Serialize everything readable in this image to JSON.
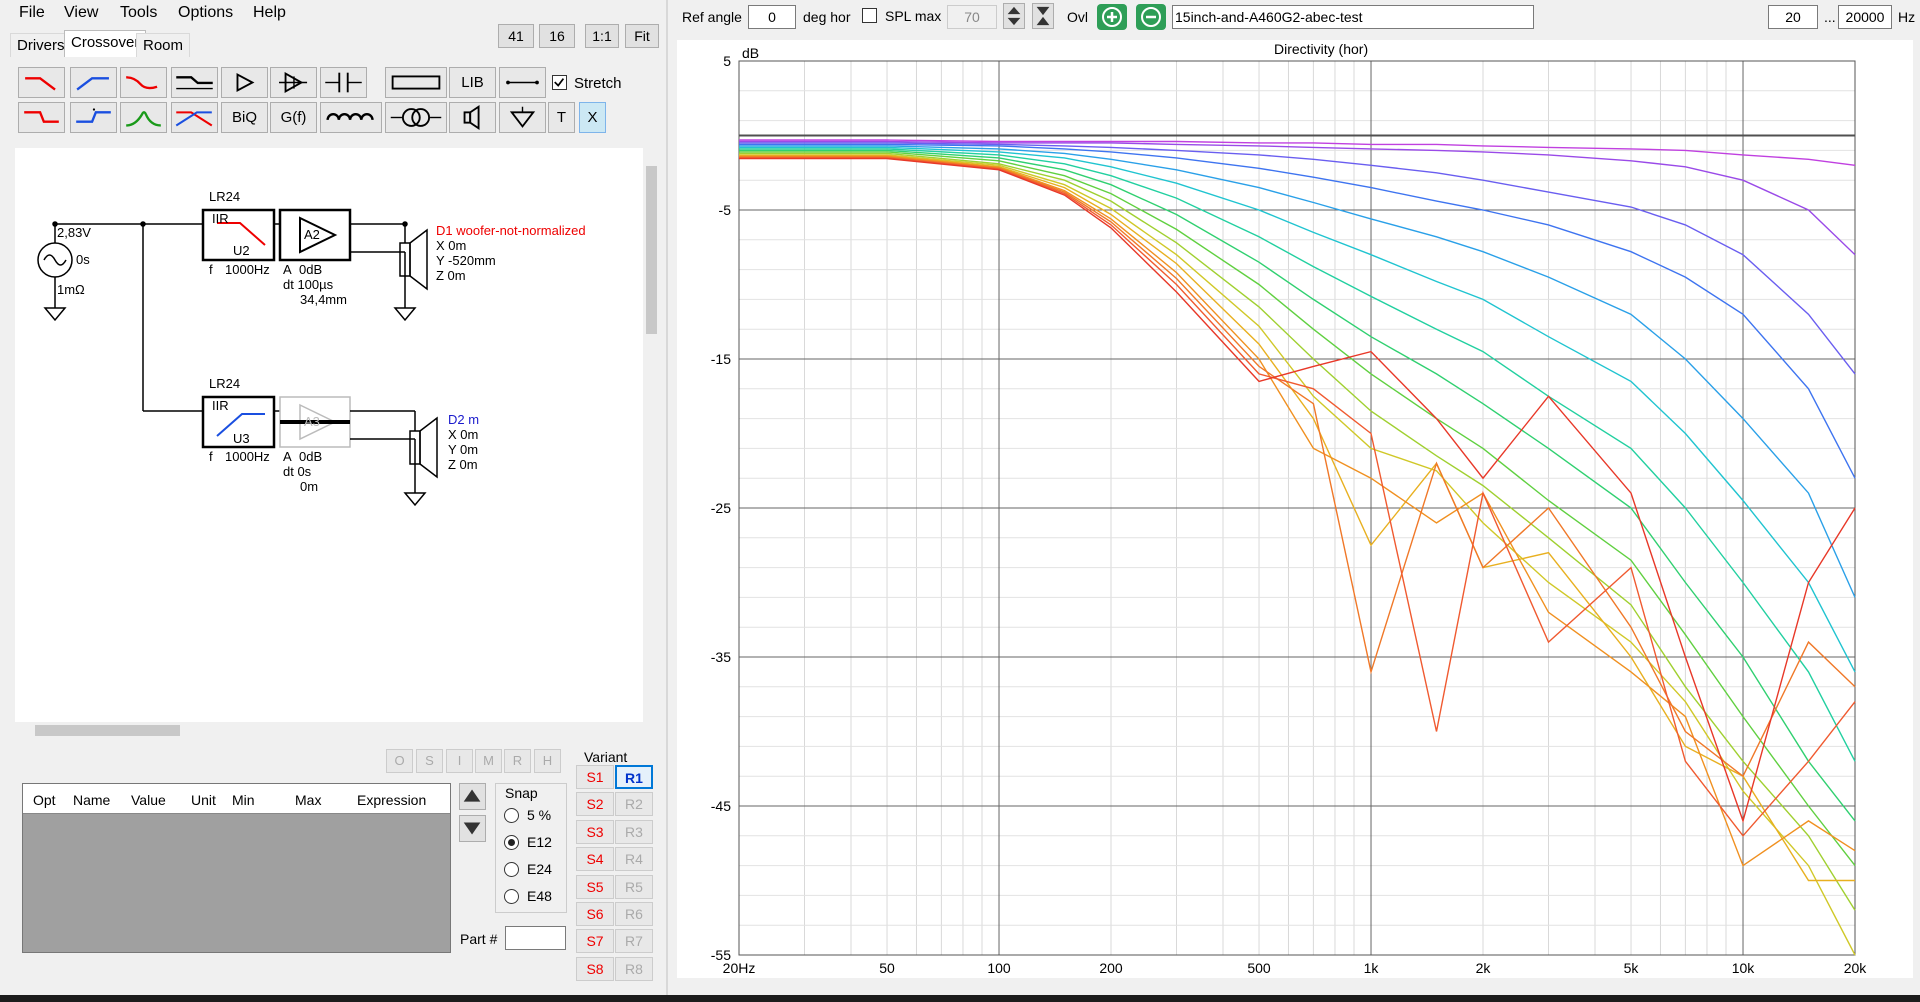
{
  "menu": [
    "File",
    "View",
    "Tools",
    "Options",
    "Help"
  ],
  "tabs": [
    "Drivers",
    "Crossover",
    "Room"
  ],
  "zoom_buttons": [
    "41",
    "16",
    "1:1",
    "Fit"
  ],
  "toolbar": {
    "lib_label": "LIB",
    "biq_label": "BiQ",
    "gf_label": "G(f)",
    "t_label": "T",
    "x_label": "X",
    "stretch_label": "Stretch",
    "stretch_checked": true
  },
  "schematic": {
    "source_voltage": "2,83V",
    "source_delay": "0s",
    "source_resistance": "1mΩ",
    "block1_type": "LR24",
    "block1_iir": "IIR",
    "block1_name": "U2",
    "block1_f": "f",
    "block1_freq": "1000Hz",
    "amp1_name": "A2",
    "amp1_a": "A",
    "amp1_gain": "0dB",
    "amp1_dt": "dt 100µs",
    "amp1_dist": "34,4mm",
    "d1_label": "D1 woofer-not-normalized",
    "d1_x": "X 0m",
    "d1_y": "Y -520mm",
    "d1_z": "Z 0m",
    "block2_type": "LR24",
    "block2_iir": "IIR",
    "block2_name": "U3",
    "block2_f": "f",
    "block2_freq": "1000Hz",
    "amp2_name": "A3",
    "amp2_a": "A",
    "amp2_gain": "0dB",
    "amp2_dt": "dt 0s",
    "amp2_dist": "0m",
    "d2_label": "D2 m",
    "d2_x": "X 0m",
    "d2_y": "Y 0m",
    "d2_z": "Z 0m"
  },
  "opt_buttons": [
    "O",
    "S",
    "I",
    "M",
    "R",
    "H"
  ],
  "opt_table": {
    "headers": [
      "Opt",
      "Name",
      "Value",
      "Unit",
      "Min",
      "Max",
      "Expression"
    ]
  },
  "snap": {
    "label": "Snap",
    "options": [
      "5 %",
      "E12",
      "E24",
      "E48"
    ],
    "selected": "E12"
  },
  "part_label": "Part #",
  "part_value": "",
  "variant": {
    "label": "Variant",
    "s_buttons": [
      "S1",
      "S2",
      "S3",
      "S4",
      "S5",
      "S6",
      "S7",
      "S8"
    ],
    "r_buttons": [
      "R1",
      "R2",
      "R3",
      "R4",
      "R5",
      "R6",
      "R7",
      "R8"
    ],
    "selected": "R1"
  },
  "top_bar": {
    "ref_angle_label": "Ref angle",
    "ref_angle_value": "0",
    "deg_label": "deg hor",
    "spl_max_label": "SPL max",
    "spl_max_value": "70",
    "spl_max_checked": false,
    "ovl_label": "Ovl",
    "overlay_name": "15inch-and-A460G2-abec-test",
    "freq_min": "20",
    "freq_sep": "...",
    "freq_max": "20000",
    "hz_label": "Hz"
  },
  "colors": {
    "accent_blue": "#0078d7",
    "red": "#e00000",
    "blue_text": "#1a1acc"
  },
  "chart_data": {
    "type": "line",
    "title": "Directivity (hor)",
    "ylabel": "dB",
    "xlabel": "",
    "x_scale": "log",
    "xlim": [
      20,
      20000
    ],
    "ylim": [
      -55,
      5
    ],
    "x_ticks": [
      20,
      50,
      100,
      200,
      500,
      1000,
      2000,
      5000,
      10000,
      20000
    ],
    "x_tick_labels": [
      "20Hz",
      "50",
      "100",
      "200",
      "500",
      "1k",
      "2k",
      "5k",
      "10k",
      "20k"
    ],
    "y_ticks": [
      5,
      -5,
      -15,
      -25,
      -35,
      -45,
      -55
    ],
    "y_tick_labels": [
      "5",
      "-5",
      "-15",
      "-25",
      "-35",
      "-45",
      "-55"
    ],
    "grid": true,
    "legend": "none",
    "x": [
      20,
      50,
      100,
      150,
      200,
      300,
      500,
      700,
      1000,
      1500,
      2000,
      3000,
      5000,
      7000,
      10000,
      15000,
      20000
    ],
    "series": [
      {
        "color": "#505050",
        "values": [
          0,
          0,
          0,
          0,
          0,
          0,
          0,
          0,
          0,
          0,
          0,
          0,
          0,
          0,
          0,
          0,
          0
        ]
      },
      {
        "color": "#c040e0",
        "values": [
          -0.3,
          -0.3,
          -0.4,
          -0.4,
          -0.4,
          -0.4,
          -0.5,
          -0.5,
          -0.6,
          -0.6,
          -0.7,
          -0.8,
          -0.9,
          -1.0,
          -1.3,
          -1.6,
          -2.0
        ]
      },
      {
        "color": "#9a4ae8",
        "values": [
          -0.4,
          -0.4,
          -0.5,
          -0.5,
          -0.5,
          -0.6,
          -0.7,
          -0.8,
          -0.9,
          -1.0,
          -1.1,
          -1.3,
          -1.7,
          -2.1,
          -3.0,
          -5.0,
          -8.0
        ]
      },
      {
        "color": "#6a5ef0",
        "values": [
          -0.5,
          -0.5,
          -0.6,
          -0.7,
          -0.8,
          -1.0,
          -1.3,
          -1.6,
          -2.0,
          -2.5,
          -3.0,
          -3.8,
          -4.8,
          -6.0,
          -8.0,
          -12.0,
          -16.0
        ]
      },
      {
        "color": "#3e74f0",
        "values": [
          -0.6,
          -0.6,
          -0.7,
          -0.9,
          -1.1,
          -1.5,
          -2.2,
          -2.8,
          -3.5,
          -4.4,
          -5.0,
          -6.0,
          -7.8,
          -9.5,
          -12.0,
          -17.0,
          -23.0
        ]
      },
      {
        "color": "#2aa0e8",
        "values": [
          -0.7,
          -0.7,
          -0.9,
          -1.2,
          -1.6,
          -2.3,
          -3.5,
          -4.5,
          -5.6,
          -6.8,
          -7.8,
          -9.5,
          -12.0,
          -15.0,
          -19.0,
          -24.0,
          -31.0
        ]
      },
      {
        "color": "#20c4d0",
        "values": [
          -0.8,
          -0.8,
          -1.1,
          -1.5,
          -2.1,
          -3.2,
          -5.0,
          -6.5,
          -8.0,
          -9.8,
          -11.0,
          -13.5,
          -16.5,
          -20.0,
          -24.5,
          -30.0,
          -36.0
        ]
      },
      {
        "color": "#22d0a0",
        "values": [
          -0.9,
          -0.9,
          -1.3,
          -1.9,
          -2.7,
          -4.2,
          -6.8,
          -8.8,
          -10.8,
          -13.0,
          -14.5,
          -17.5,
          -21.0,
          -25.0,
          -30.0,
          -36.0,
          -42.0
        ]
      },
      {
        "color": "#30d070",
        "values": [
          -1.0,
          -1.0,
          -1.5,
          -2.3,
          -3.3,
          -5.3,
          -8.5,
          -11.0,
          -13.5,
          -16.0,
          -18.0,
          -21.0,
          -25.0,
          -30.0,
          -35.0,
          -42.0,
          -46.0
        ]
      },
      {
        "color": "#60d040",
        "values": [
          -1.1,
          -1.1,
          -1.7,
          -2.7,
          -3.9,
          -6.3,
          -10.0,
          -13.0,
          -16.0,
          -19.0,
          -21.0,
          -24.5,
          -28.5,
          -33.5,
          -39.0,
          -45.0,
          -49.0
        ]
      },
      {
        "color": "#a0d030",
        "values": [
          -1.2,
          -1.2,
          -1.9,
          -3.0,
          -4.4,
          -7.2,
          -11.5,
          -15.0,
          -18.5,
          -21.5,
          -23.5,
          -27.0,
          -31.5,
          -37.0,
          -42.0,
          -47.0,
          -52.0
        ]
      },
      {
        "color": "#d0c828",
        "values": [
          -1.3,
          -1.3,
          -2.0,
          -3.3,
          -4.9,
          -8.0,
          -12.8,
          -17.5,
          -21.0,
          -22.5,
          -26.0,
          -30.0,
          -34.0,
          -38.0,
          -44.0,
          -49.0,
          -55.0
        ]
      },
      {
        "color": "#e8b020",
        "values": [
          -1.35,
          -1.35,
          -2.1,
          -3.5,
          -5.3,
          -8.6,
          -14.0,
          -19.0,
          -27.5,
          -22.0,
          -29.0,
          -28.0,
          -35.0,
          -41.0,
          -43.0,
          -50.0,
          -50.0
        ]
      },
      {
        "color": "#f09020",
        "values": [
          -1.4,
          -1.4,
          -2.15,
          -3.7,
          -5.6,
          -9.2,
          -15.0,
          -21.0,
          -23.0,
          -26.0,
          -24.0,
          -32.0,
          -36.0,
          -39.0,
          -49.0,
          -46.0,
          -48.0
        ]
      },
      {
        "color": "#f07828",
        "values": [
          -1.45,
          -1.45,
          -2.2,
          -3.8,
          -5.8,
          -9.6,
          -15.5,
          -18.0,
          -36.0,
          -22.0,
          -29.0,
          -25.0,
          -33.0,
          -40.0,
          -43.0,
          -34.0,
          -37.0
        ]
      },
      {
        "color": "#f05a30",
        "values": [
          -1.5,
          -1.5,
          -2.25,
          -3.9,
          -6.0,
          -10.0,
          -16.0,
          -17.0,
          -20.0,
          -40.0,
          -24.0,
          -34.0,
          -29.0,
          -42.0,
          -47.0,
          -42.0,
          -38.0
        ]
      },
      {
        "color": "#e83828",
        "values": [
          -1.55,
          -1.55,
          -2.3,
          -4.0,
          -6.2,
          -10.5,
          -16.5,
          -15.5,
          -14.5,
          -19.0,
          -23.0,
          -17.5,
          -24.0,
          -35.0,
          -46.0,
          -30.0,
          -25.0
        ]
      }
    ]
  }
}
